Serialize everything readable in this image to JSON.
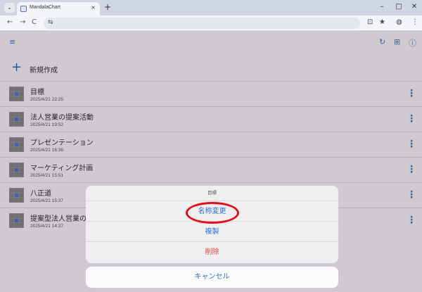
{
  "browser": {
    "tab_title": "MandalaChart",
    "tab_close": "×",
    "new_tab": "+",
    "menu": "⌄",
    "win_min": "–",
    "win_max": "□",
    "win_close": "✕",
    "icons": {
      "back": "←",
      "forward": "→",
      "reload": "C",
      "tune": "⇆",
      "cast": "⊡",
      "bookmark": "★",
      "profile": "◍",
      "more": "⋮"
    }
  },
  "app": {
    "toolbar_icons": {
      "sort": "≡",
      "refresh": "↻",
      "add_file": "⊞",
      "info": "ⓘ"
    },
    "new_label": "新規作成",
    "plus": "+",
    "kebab": "⋮",
    "items": [
      {
        "title": "目標",
        "date": "2025/4/21 22:25"
      },
      {
        "title": "法人営業の提案活動",
        "date": "2025/4/21 19:52"
      },
      {
        "title": "プレゼンテーション",
        "date": "2025/4/21 16:36"
      },
      {
        "title": "マーケティング計画",
        "date": "2025/4/21 15:51"
      },
      {
        "title": "八正道",
        "date": "2025/4/21 15:37"
      },
      {
        "title": "提案型法人営業の",
        "date": "2025/4/21 14:37"
      }
    ]
  },
  "sheet": {
    "title": "目標",
    "rename": "名称変更",
    "duplicate": "複製",
    "delete": "削除",
    "cancel": "キャンセル"
  },
  "colors": {
    "accent": "#2f6fd6",
    "danger": "#e0473c",
    "highlight": "#e0111b"
  }
}
